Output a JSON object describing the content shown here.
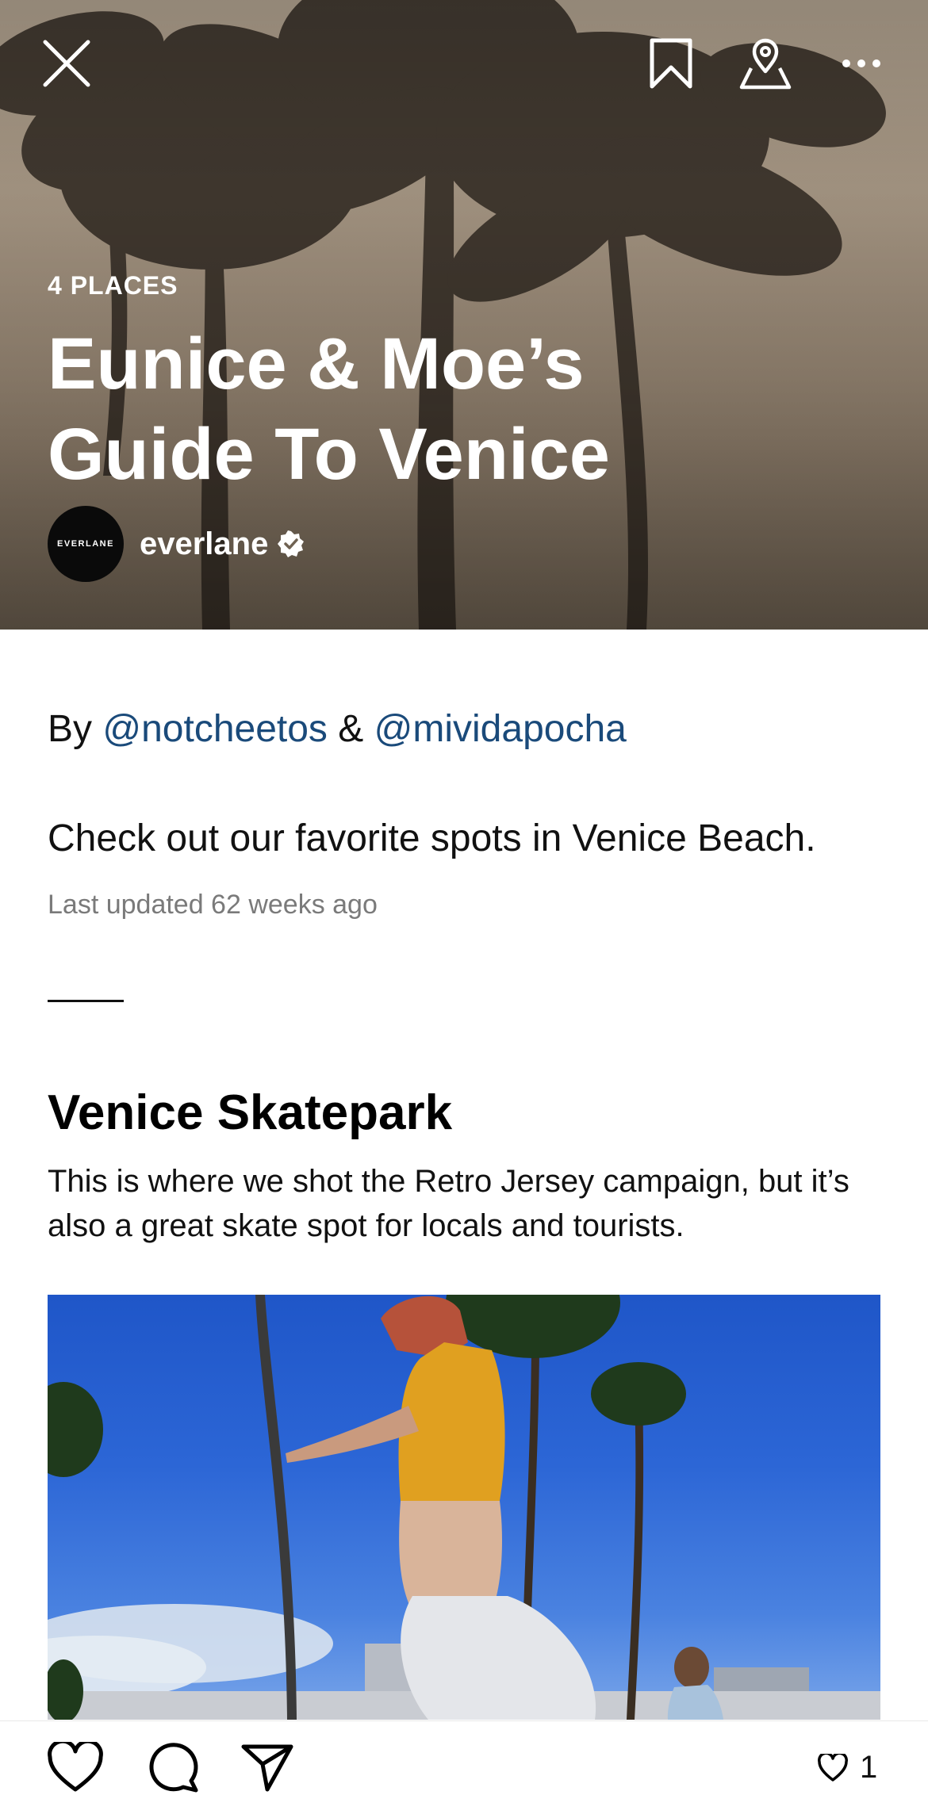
{
  "hero": {
    "places_count": "4 PLACES",
    "title": "Eunice & Moe’s Guide To Venice",
    "author": {
      "name": "everlane",
      "avatar_text": "EVERLANE",
      "verified": true
    }
  },
  "top_bar": {
    "icons": [
      "close-icon",
      "bookmark-icon",
      "map-pin-icon",
      "more-icon"
    ]
  },
  "byline": {
    "prefix": "By",
    "author1": "@notcheetos",
    "separator": "&",
    "author2": "@mividapocha"
  },
  "description": "Check out our favorite spots in Venice Beach.",
  "updated": "Last updated 62 weeks ago",
  "places": [
    {
      "title": "Venice Skatepark",
      "description": "This is where we shot the Retro Jersey campaign, but it’s also a great skate spot for locals and tourists."
    }
  ],
  "bottom_bar": {
    "icons": [
      "heart-icon",
      "comment-icon",
      "send-icon"
    ],
    "like_count": "1"
  },
  "colors": {
    "mention": "#1a4a7a",
    "text": "#111111",
    "muted": "#7a7a7a"
  }
}
